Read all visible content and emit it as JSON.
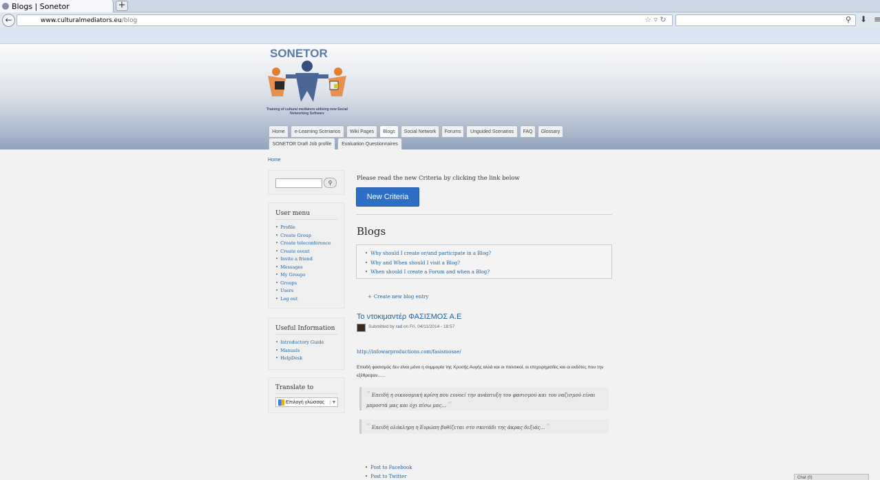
{
  "browser": {
    "tab_title": "Blogs | Sonetor",
    "new_tab": "+",
    "url_domain": "www.culturalmediators.eu",
    "url_path": "/blog"
  },
  "site": {
    "logo_text": "SONETOR",
    "tagline": "Training of cultural mediators utilizing new Social Networking Software"
  },
  "nav": {
    "tabs": [
      "Home",
      "e-Learning Scenarios",
      "Wiki Pages",
      "Blogs",
      "Social Network",
      "Forums",
      "Unguided Scenarios",
      "FAQ",
      "Glossary"
    ],
    "tabs_row2": [
      "SONETOR Draft Job profile",
      "Evaluation Questionnaires"
    ],
    "active": "Blogs"
  },
  "breadcrumb": "Home",
  "sidebar": {
    "search_button_icon": "search-icon",
    "user_menu": {
      "title": "User menu",
      "items": [
        "Profile",
        "Create Group",
        "Create teleconference",
        "Create event",
        "Invite a friend",
        "Messages",
        "My Groups",
        "Groups",
        "Users",
        "Log out"
      ]
    },
    "useful_info": {
      "title": "Useful Information",
      "items": [
        "Introductory Guide",
        "Manuals",
        "HelpDesk"
      ]
    },
    "translate": {
      "title": "Translate to",
      "select_value": "Επιλογή γλώσσας"
    }
  },
  "main": {
    "intro": "Please read the new Criteria by clicking the link below",
    "criteria_button": "New Criteria",
    "heading": "Blogs",
    "faq_links": [
      "Why should I create or/and participate in a Blog?",
      "Why and When should I visit a Blog?",
      "When should I create a Forum and when a Blog?"
    ],
    "create_entry": "Create new blog entry",
    "post": {
      "title": "Το ντοκιμαντέρ ΦΑΣΙΣΜΟΣ Α.Ε",
      "submitted_prefix": "Submitted by",
      "author": "rad",
      "date": "on Fri, 04/11/2014 - 18:57",
      "link": "http://infowarproductions.com/fasismosae/",
      "paragraph": "Επειδή φασισμός δεν είναι μόνο η συμμορία της Χρυσής Αυγής αλλά και οι πολιτικοί, οι επιχειρηματίες και οι εκδότες που την εξέθρεψαν......",
      "quote1": "Επειδή η οικονομική κρίση που ευνοεί την ανάπτυξη του φασισμού και του ναζισμού είναι μπροστά μας και όχι πίσω μας...",
      "quote2": "Επειδή ολόκληρη η Ευρώπη βυθίζεται στο σκοτάδι της άκρας δεξιάς...",
      "share": [
        "Post to Facebook",
        "Post to Twitter"
      ]
    }
  },
  "chat": "Chat (0)",
  "colors": {
    "link": "#1d5fa0",
    "button": "#2d6fc4",
    "header_bottom": "#8fa2bd"
  }
}
